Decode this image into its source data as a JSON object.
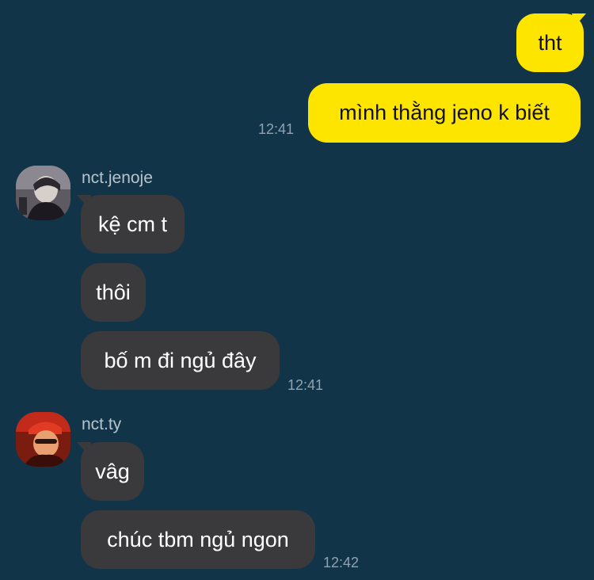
{
  "colors": {
    "background": "#123449",
    "outgoing_bubble": "#FEE500",
    "incoming_bubble": "#3A3A3C",
    "timestamp": "#8FA2B0",
    "sender_name": "#B7C4CE"
  },
  "outgoing": {
    "messages": [
      "tht",
      "mình thằng jeno k biết"
    ],
    "time": "12:41"
  },
  "groups": [
    {
      "sender": "nct.jenoje",
      "avatar_icon": "user-avatar-icon",
      "messages": [
        "kệ cm t",
        "thôi",
        "bố m đi ngủ đây"
      ],
      "time": "12:41"
    },
    {
      "sender": "nct.ty",
      "avatar_icon": "user-avatar-icon",
      "messages": [
        "vâg",
        "chúc tbm ngủ ngon"
      ],
      "time": "12:42"
    }
  ]
}
